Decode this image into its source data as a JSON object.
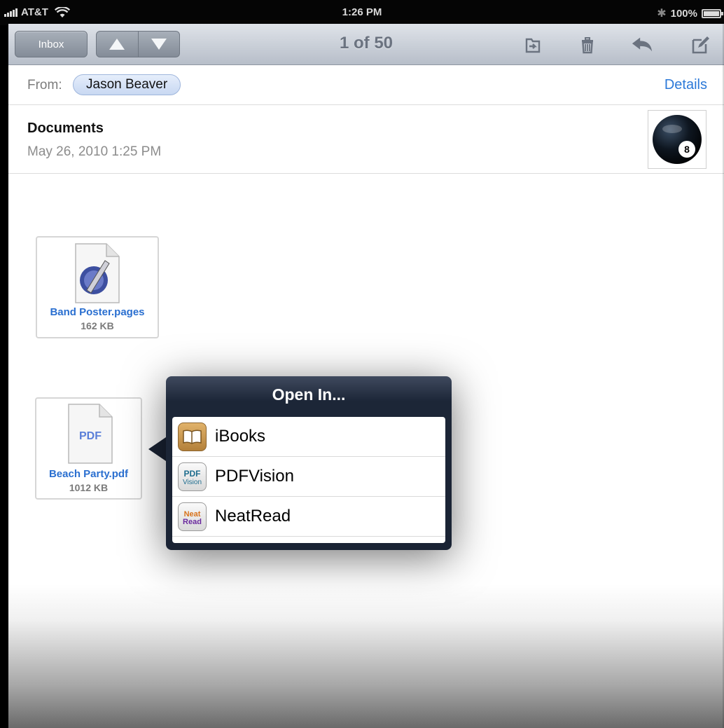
{
  "status_bar": {
    "carrier": "AT&T",
    "time": "1:26 PM",
    "battery": "100%",
    "battery_level": 1.0
  },
  "toolbar": {
    "inbox_label": "Inbox",
    "counter": "1 of 50",
    "icons": [
      "up-arrow-icon",
      "down-arrow-icon",
      "move-folder-icon",
      "trash-icon",
      "reply-icon",
      "compose-icon"
    ]
  },
  "message": {
    "from_label": "From:",
    "sender": "Jason Beaver",
    "details_label": "Details",
    "subject": "Documents",
    "date": "May 26, 2010 1:25 PM"
  },
  "attachments": [
    {
      "name": "Band Poster.pages",
      "size": "162 KB",
      "icon": "pages-document-icon"
    },
    {
      "name": "Beach Party.pdf",
      "size": "1012 KB",
      "icon": "pdf-document-icon",
      "icon_text": "PDF"
    }
  ],
  "popover": {
    "title": "Open In...",
    "items": [
      {
        "label": "iBooks",
        "icon": "ibooks-icon"
      },
      {
        "label": "PDFVision",
        "icon": "pdfvision-icon",
        "icon_text_1": "PDF",
        "icon_text_2": "Vision"
      },
      {
        "label": "NeatRead",
        "icon": "neatread-icon",
        "icon_text_1": "Neat",
        "icon_text_2": "Read"
      }
    ]
  },
  "colors": {
    "accent_link": "#2c79d8",
    "popover_bg": "#1a2334",
    "toolbar_gradient_top": "#dfe3e9",
    "toolbar_gradient_bottom": "#b7bec9"
  }
}
